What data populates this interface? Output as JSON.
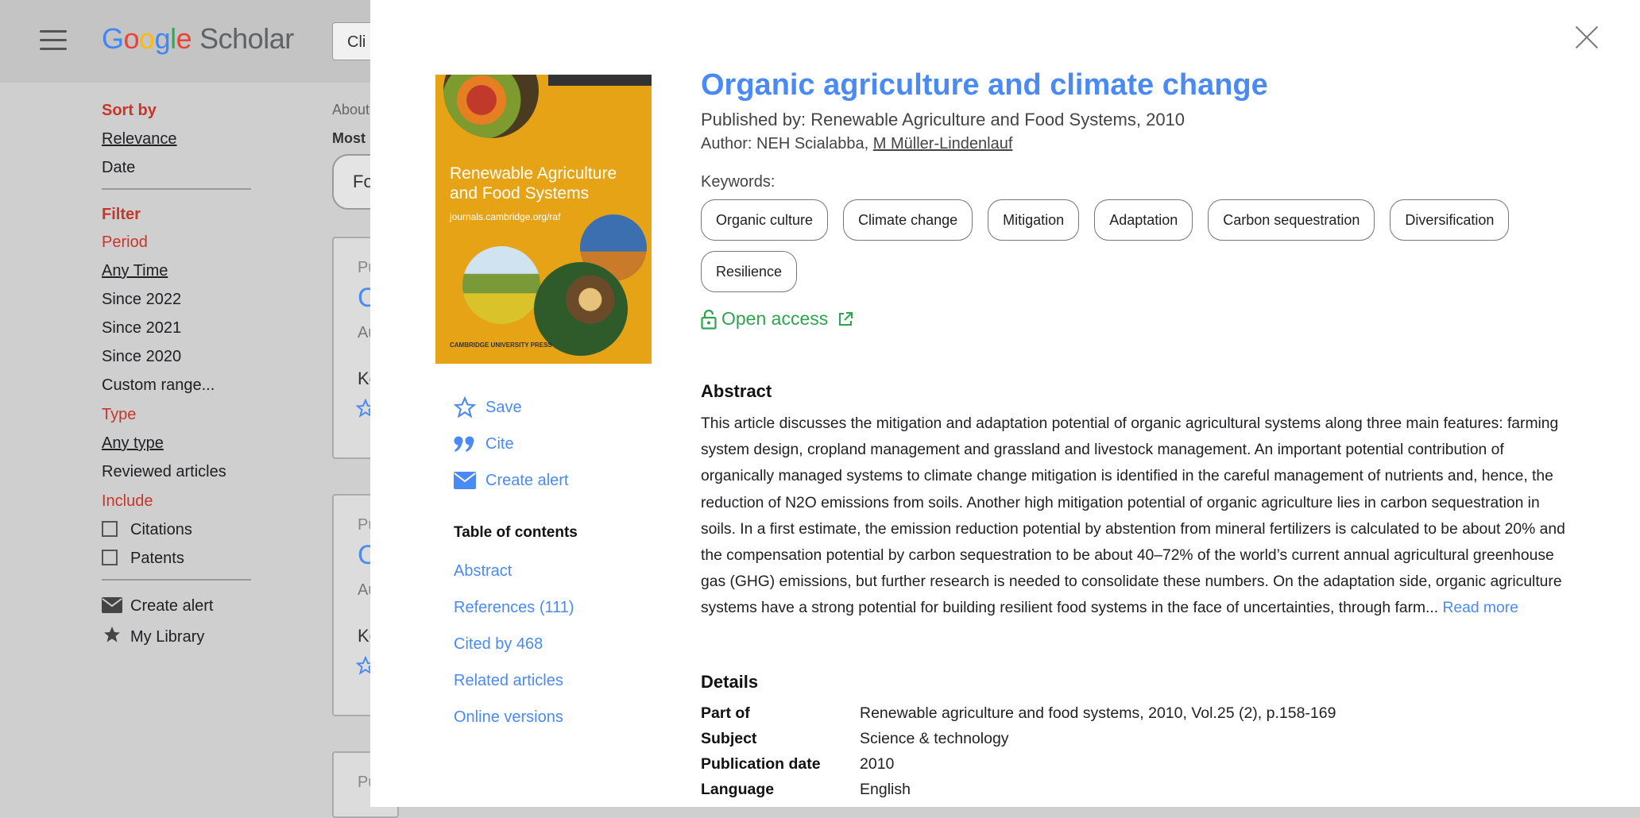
{
  "background": {
    "logo": {
      "g1": "G",
      "g2": "o",
      "g3": "o",
      "g4": "g",
      "g5": "l",
      "g6": "e",
      "rest": "Scholar"
    },
    "search_value": "Cli",
    "sidebar": {
      "sort_title": "Sort by",
      "sort_items": [
        "Relevance",
        "Date"
      ],
      "filter_title": "Filter",
      "period_title": "Period",
      "period_items": [
        "Any Time",
        "Since 2022",
        "Since 2021",
        "Since 2020",
        "Custom range..."
      ],
      "type_title": "Type",
      "type_items": [
        "Any type",
        "Reviewed articles"
      ],
      "include_title": "Include",
      "include_items": [
        "Citations",
        "Patents"
      ],
      "create_alert": "Create alert",
      "my_library": "My Library"
    },
    "results_label": "About",
    "most_label": "Most r",
    "pill_text": "Fo",
    "cards": [
      {
        "pub": "Pu",
        "title": "C",
        "author": "Au",
        "kw": "Ke"
      },
      {
        "pub": "Pu",
        "title": "C",
        "author": "Au",
        "kw": "Ke"
      },
      {
        "pub": "Pu"
      }
    ]
  },
  "modal": {
    "cover": {
      "journal": "Renewable Agriculture and Food Systems",
      "url": "journals.cambridge.org/raf",
      "publisher": "CAMBRIDGE UNIVERSITY PRESS",
      "colors": {
        "background": "#e6a315"
      }
    },
    "actions": [
      {
        "label": "Save",
        "icon": "star-icon"
      },
      {
        "label": "Cite",
        "icon": "quote-icon"
      },
      {
        "label": "Create alert",
        "icon": "mail-icon"
      }
    ],
    "toc": {
      "title": "Table of contents",
      "items": [
        "Abstract",
        "References (111)",
        "Cited by 468",
        "Related articles",
        "Online versions"
      ]
    },
    "title": "Organic agriculture and climate change",
    "published_by": "Published by: Renewable Agriculture and Food Systems, 2010",
    "author_prefix": "Author: NEH Scialabba, ",
    "author_link": "M Müller-Lindenlauf",
    "keywords_label": "Keywords:",
    "keywords": [
      "Organic culture",
      "Climate change",
      "Mitigation",
      "Adaptation",
      "Carbon sequestration",
      "Diversification",
      "Resilience"
    ],
    "open_access": "Open access",
    "abstract_heading": "Abstract",
    "abstract_text": "This article discusses the mitigation and adaptation potential of organic agricultural systems along three main features: farming system design, cropland management and grassland and livestock management. An important potential contribution of organically managed systems to climate change mitigation is identified in the careful management of nutrients and, hence, the reduction of N2O emissions from soils. Another high mitigation potential of organic agriculture lies in carbon sequestration in soils. In a first estimate, the emission reduction potential by abstention from mineral fertilizers is calculated to be about 20% and the compensation potential by carbon sequestration to be about 40–72% of the world’s current annual agricultural greenhouse gas (GHG) emissions, but further research is needed to consolidate these numbers. On the adaptation side, organic agriculture systems have a strong potential for building resilient food systems in the face of uncertainties, through farm...",
    "read_more": "Read more",
    "details_heading": "Details",
    "details": [
      {
        "k": "Part of",
        "v": "Renewable agriculture and food systems, 2010, Vol.25 (2), p.158-169"
      },
      {
        "k": "Subject",
        "v": "Science & technology"
      },
      {
        "k": "Publication date",
        "v": "2010"
      },
      {
        "k": "Language",
        "v": "English"
      }
    ],
    "colors": {
      "link": "#4a8af4",
      "open_access": "#2ea44f",
      "accent_red": "#c5362b"
    }
  }
}
